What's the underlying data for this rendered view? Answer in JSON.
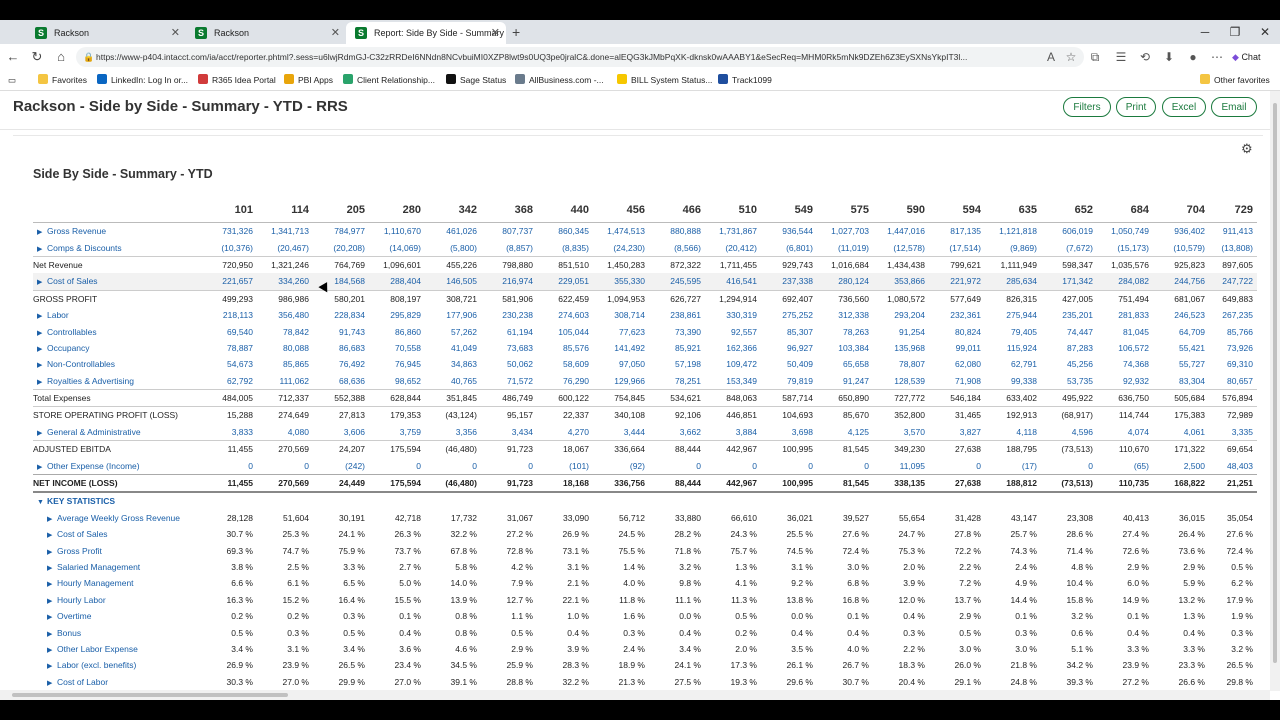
{
  "browser": {
    "tabs": [
      {
        "title": "Rackson",
        "active": false
      },
      {
        "title": "Rackson",
        "active": false
      },
      {
        "title": "Report: Side By Side - Summary - ...",
        "active": true
      }
    ],
    "new_tab": "+",
    "url": "https://www-p404.intacct.com/ia/acct/reporter.phtml?.sess=u6lwjRdmGJ-C32zRRDeI6NNdn8NCvbuiMI0XZP8lwt9s0UQ3pe0jralC&.done=alEQG3kJMbPqXK-dknsk0wAAABY1&eSecReq=MHM0Rk5mNk9DZEh6Z3EySXNsYkpIT3l...",
    "bookmarks": [
      "Favorites",
      "LinkedIn: Log In or...",
      "R365 Idea Portal",
      "PBI Apps",
      "Client Relationship...",
      "Sage Status",
      "AllBusiness.com -...",
      "BILL System Status...",
      "Track1099"
    ],
    "other_favorites": "Other favorites",
    "chat_label": "Chat",
    "colors": {
      "tab_bar": "#dfe3e8",
      "accent_green": "#1b7a3e",
      "link_blue": "#1a5fa8"
    }
  },
  "header": {
    "title": "Rackson - Side by Side - Summary - YTD - RRS",
    "buttons": [
      "Filters",
      "Print",
      "Excel",
      "Email"
    ]
  },
  "report": {
    "subtitle": "Side By Side - Summary - YTD",
    "columns": [
      "101",
      "114",
      "205",
      "280",
      "342",
      "368",
      "440",
      "456",
      "466",
      "510",
      "549",
      "575",
      "590",
      "594",
      "635",
      "652",
      "684",
      "704",
      "729"
    ],
    "rows": [
      {
        "label": "Gross Revenue",
        "kind": "link",
        "values": [
          "731,326",
          "1,341,713",
          "784,977",
          "1,110,670",
          "461,026",
          "807,737",
          "860,345",
          "1,474,513",
          "880,888",
          "1,731,867",
          "936,544",
          "1,027,703",
          "1,447,016",
          "817,135",
          "1,121,818",
          "606,019",
          "1,050,749",
          "936,402",
          "911,413"
        ]
      },
      {
        "label": "Comps & Discounts",
        "kind": "link",
        "values": [
          "(10,376)",
          "(20,467)",
          "(20,208)",
          "(14,069)",
          "(5,800)",
          "(8,857)",
          "(8,835)",
          "(24,230)",
          "(8,566)",
          "(20,412)",
          "(6,801)",
          "(11,019)",
          "(12,578)",
          "(17,514)",
          "(9,869)",
          "(7,672)",
          "(15,173)",
          "(10,579)",
          "(13,808)"
        ]
      },
      {
        "label": "Net Revenue",
        "kind": "total",
        "values": [
          "720,950",
          "1,321,246",
          "764,769",
          "1,096,601",
          "455,226",
          "798,880",
          "851,510",
          "1,450,283",
          "872,322",
          "1,711,455",
          "929,743",
          "1,016,684",
          "1,434,438",
          "799,621",
          "1,111,949",
          "598,347",
          "1,035,576",
          "925,823",
          "897,605"
        ]
      },
      {
        "label": "Cost of Sales",
        "kind": "link",
        "values": [
          "221,657",
          "334,260",
          "184,568",
          "288,404",
          "146,505",
          "216,974",
          "229,051",
          "355,330",
          "245,595",
          "416,541",
          "237,338",
          "280,124",
          "353,866",
          "221,972",
          "285,634",
          "171,342",
          "284,082",
          "244,756",
          "247,722"
        ]
      },
      {
        "label": "GROSS PROFIT",
        "kind": "bigtotal",
        "values": [
          "499,293",
          "986,986",
          "580,201",
          "808,197",
          "308,721",
          "581,906",
          "622,459",
          "1,094,953",
          "626,727",
          "1,294,914",
          "692,407",
          "736,560",
          "1,080,572",
          "577,649",
          "826,315",
          "427,005",
          "751,494",
          "681,067",
          "649,883"
        ]
      },
      {
        "label": "Labor",
        "kind": "link",
        "values": [
          "218,113",
          "356,480",
          "228,834",
          "295,829",
          "177,906",
          "230,238",
          "274,603",
          "308,714",
          "238,861",
          "330,319",
          "275,252",
          "312,338",
          "293,204",
          "232,361",
          "275,944",
          "235,201",
          "281,833",
          "246,523",
          "267,235"
        ]
      },
      {
        "label": "Controllables",
        "kind": "link",
        "values": [
          "69,540",
          "78,842",
          "91,743",
          "86,860",
          "57,262",
          "61,194",
          "105,044",
          "77,623",
          "73,390",
          "92,557",
          "85,307",
          "78,263",
          "91,254",
          "80,824",
          "79,405",
          "74,447",
          "81,045",
          "64,709",
          "85,766"
        ]
      },
      {
        "label": "Occupancy",
        "kind": "link",
        "values": [
          "78,887",
          "80,088",
          "86,683",
          "70,558",
          "41,049",
          "73,683",
          "85,576",
          "141,492",
          "85,921",
          "162,366",
          "96,927",
          "103,384",
          "135,968",
          "99,011",
          "115,924",
          "87,283",
          "106,572",
          "55,421",
          "73,926"
        ]
      },
      {
        "label": "Non-Controllables",
        "kind": "link",
        "values": [
          "54,673",
          "85,865",
          "76,492",
          "76,945",
          "34,863",
          "50,062",
          "58,609",
          "97,050",
          "57,198",
          "109,472",
          "50,409",
          "65,658",
          "78,807",
          "62,080",
          "62,791",
          "45,256",
          "74,368",
          "55,727",
          "69,310"
        ]
      },
      {
        "label": "Royalties & Advertising",
        "kind": "link",
        "values": [
          "62,792",
          "111,062",
          "68,636",
          "98,652",
          "40,765",
          "71,572",
          "76,290",
          "129,966",
          "78,251",
          "153,349",
          "79,819",
          "91,247",
          "128,539",
          "71,908",
          "99,338",
          "53,735",
          "92,932",
          "83,304",
          "80,657"
        ]
      },
      {
        "label": "Total Expenses",
        "kind": "total",
        "values": [
          "484,005",
          "712,337",
          "552,388",
          "628,844",
          "351,845",
          "486,749",
          "600,122",
          "754,845",
          "534,621",
          "848,063",
          "587,714",
          "650,890",
          "727,772",
          "546,184",
          "633,402",
          "495,922",
          "636,750",
          "505,684",
          "576,894"
        ]
      },
      {
        "label": "STORE OPERATING PROFIT (LOSS)",
        "kind": "bigtotal",
        "values": [
          "15,288",
          "274,649",
          "27,813",
          "179,353",
          "(43,124)",
          "95,157",
          "22,337",
          "340,108",
          "92,106",
          "446,851",
          "104,693",
          "85,670",
          "352,800",
          "31,465",
          "192,913",
          "(68,917)",
          "114,744",
          "175,383",
          "72,989"
        ]
      },
      {
        "label": "General & Administrative",
        "kind": "link",
        "values": [
          "3,833",
          "4,080",
          "3,606",
          "3,759",
          "3,356",
          "3,434",
          "4,270",
          "3,444",
          "3,662",
          "3,884",
          "3,698",
          "4,125",
          "3,570",
          "3,827",
          "4,118",
          "4,596",
          "4,074",
          "4,061",
          "3,335"
        ]
      },
      {
        "label": "ADJUSTED EBITDA",
        "kind": "bigtotal",
        "values": [
          "11,455",
          "270,569",
          "24,207",
          "175,594",
          "(46,480)",
          "91,723",
          "18,067",
          "336,664",
          "88,444",
          "442,967",
          "100,995",
          "81,545",
          "349,230",
          "27,638",
          "188,795",
          "(73,513)",
          "110,670",
          "171,322",
          "69,654"
        ]
      },
      {
        "label": "Other Expense (Income)",
        "kind": "link",
        "values": [
          "0",
          "0",
          "(242)",
          "0",
          "0",
          "0",
          "(101)",
          "(92)",
          "0",
          "0",
          "0",
          "0",
          "11,095",
          "0",
          "(17)",
          "0",
          "(65)",
          "2,500",
          "48,403"
        ]
      },
      {
        "label": "NET INCOME (LOSS)",
        "kind": "net",
        "values": [
          "11,455",
          "270,569",
          "24,449",
          "175,594",
          "(46,480)",
          "91,723",
          "18,168",
          "336,756",
          "88,444",
          "442,967",
          "100,995",
          "81,545",
          "338,135",
          "27,638",
          "188,812",
          "(73,513)",
          "110,735",
          "168,822",
          "21,251"
        ]
      },
      {
        "label": "KEY STATISTICS",
        "kind": "section",
        "values": []
      },
      {
        "label": "Average Weekly Gross Revenue",
        "kind": "stat",
        "values": [
          "28,128",
          "51,604",
          "30,191",
          "42,718",
          "17,732",
          "31,067",
          "33,090",
          "56,712",
          "33,880",
          "66,610",
          "36,021",
          "39,527",
          "55,654",
          "31,428",
          "43,147",
          "23,308",
          "40,413",
          "36,015",
          "35,054"
        ]
      },
      {
        "label": "Cost of Sales",
        "kind": "stat",
        "values": [
          "30.7 %",
          "25.3 %",
          "24.1 %",
          "26.3 %",
          "32.2 %",
          "27.2 %",
          "26.9 %",
          "24.5 %",
          "28.2 %",
          "24.3 %",
          "25.5 %",
          "27.6 %",
          "24.7 %",
          "27.8 %",
          "25.7 %",
          "28.6 %",
          "27.4 %",
          "26.4 %",
          "27.6 %"
        ]
      },
      {
        "label": "Gross Profit",
        "kind": "stat",
        "values": [
          "69.3 %",
          "74.7 %",
          "75.9 %",
          "73.7 %",
          "67.8 %",
          "72.8 %",
          "73.1 %",
          "75.5 %",
          "71.8 %",
          "75.7 %",
          "74.5 %",
          "72.4 %",
          "75.3 %",
          "72.2 %",
          "74.3 %",
          "71.4 %",
          "72.6 %",
          "73.6 %",
          "72.4 %"
        ]
      },
      {
        "label": "Salaried Management",
        "kind": "stat",
        "values": [
          "3.8 %",
          "2.5 %",
          "3.3 %",
          "2.7 %",
          "5.8 %",
          "4.2 %",
          "3.1 %",
          "1.4 %",
          "3.2 %",
          "1.3 %",
          "3.1 %",
          "3.0 %",
          "2.0 %",
          "2.2 %",
          "2.4 %",
          "4.8 %",
          "2.9 %",
          "2.9 %",
          "0.5 %"
        ]
      },
      {
        "label": "Hourly Management",
        "kind": "stat",
        "values": [
          "6.6 %",
          "6.1 %",
          "6.5 %",
          "5.0 %",
          "14.0 %",
          "7.9 %",
          "2.1 %",
          "4.0 %",
          "9.8 %",
          "4.1 %",
          "9.2 %",
          "6.8 %",
          "3.9 %",
          "7.2 %",
          "4.9 %",
          "10.4 %",
          "6.0 %",
          "5.9 %",
          "6.2 %"
        ]
      },
      {
        "label": "Hourly Labor",
        "kind": "stat",
        "values": [
          "16.3 %",
          "15.2 %",
          "16.4 %",
          "15.5 %",
          "13.9 %",
          "12.7 %",
          "22.1 %",
          "11.8 %",
          "11.1 %",
          "11.3 %",
          "13.8 %",
          "16.8 %",
          "12.0 %",
          "13.7 %",
          "14.4 %",
          "15.8 %",
          "14.9 %",
          "13.2 %",
          "17.9 %"
        ]
      },
      {
        "label": "Overtime",
        "kind": "stat",
        "values": [
          "0.2 %",
          "0.2 %",
          "0.3 %",
          "0.1 %",
          "0.8 %",
          "1.1 %",
          "1.0 %",
          "1.6 %",
          "0.0 %",
          "0.5 %",
          "0.0 %",
          "0.1 %",
          "0.4 %",
          "2.9 %",
          "0.1 %",
          "3.2 %",
          "0.1 %",
          "1.3 %",
          "1.9 %"
        ]
      },
      {
        "label": "Bonus",
        "kind": "stat",
        "values": [
          "0.5 %",
          "0.3 %",
          "0.5 %",
          "0.4 %",
          "0.8 %",
          "0.5 %",
          "0.4 %",
          "0.3 %",
          "0.4 %",
          "0.2 %",
          "0.4 %",
          "0.4 %",
          "0.3 %",
          "0.5 %",
          "0.3 %",
          "0.6 %",
          "0.4 %",
          "0.4 %",
          "0.3 %"
        ]
      },
      {
        "label": "Other Labor Expense",
        "kind": "stat",
        "values": [
          "3.4 %",
          "3.1 %",
          "3.4 %",
          "3.6 %",
          "4.6 %",
          "2.9 %",
          "3.9 %",
          "2.4 %",
          "3.4 %",
          "2.0 %",
          "3.5 %",
          "4.0 %",
          "2.2 %",
          "3.0 %",
          "3.0 %",
          "5.1 %",
          "3.3 %",
          "3.3 %",
          "3.2 %"
        ]
      },
      {
        "label": "Labor (excl. benefits)",
        "kind": "stat",
        "values": [
          "26.9 %",
          "23.9 %",
          "26.5 %",
          "23.4 %",
          "34.5 %",
          "25.9 %",
          "28.3 %",
          "18.9 %",
          "24.1 %",
          "17.3 %",
          "26.1 %",
          "26.7 %",
          "18.3 %",
          "26.0 %",
          "21.8 %",
          "34.2 %",
          "23.9 %",
          "23.3 %",
          "26.5 %"
        ]
      },
      {
        "label": "Cost of Labor",
        "kind": "stat",
        "values": [
          "30.3 %",
          "27.0 %",
          "29.9 %",
          "27.0 %",
          "39.1 %",
          "28.8 %",
          "32.2 %",
          "21.3 %",
          "27.5 %",
          "19.3 %",
          "29.6 %",
          "30.7 %",
          "20.4 %",
          "29.1 %",
          "24.8 %",
          "39.3 %",
          "27.2 %",
          "26.6 %",
          "29.8 %"
        ]
      }
    ]
  }
}
